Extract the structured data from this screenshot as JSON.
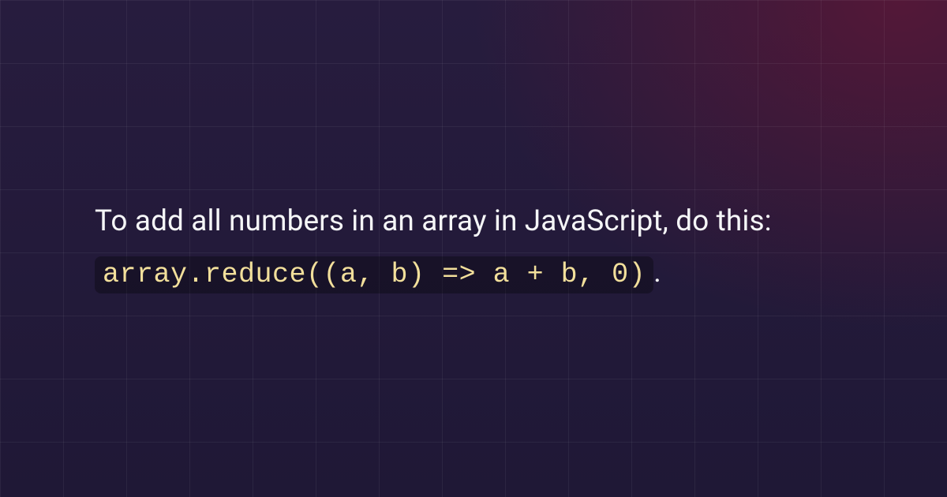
{
  "tip": {
    "text_lead": "To add all numbers in an array in JavaScript, do this: ",
    "code": "array.reduce((a, b) => a + b, 0)",
    "text_trail": "."
  },
  "colors": {
    "code_fg": "#f2df9b",
    "body_fg": "#f5f6f7"
  }
}
